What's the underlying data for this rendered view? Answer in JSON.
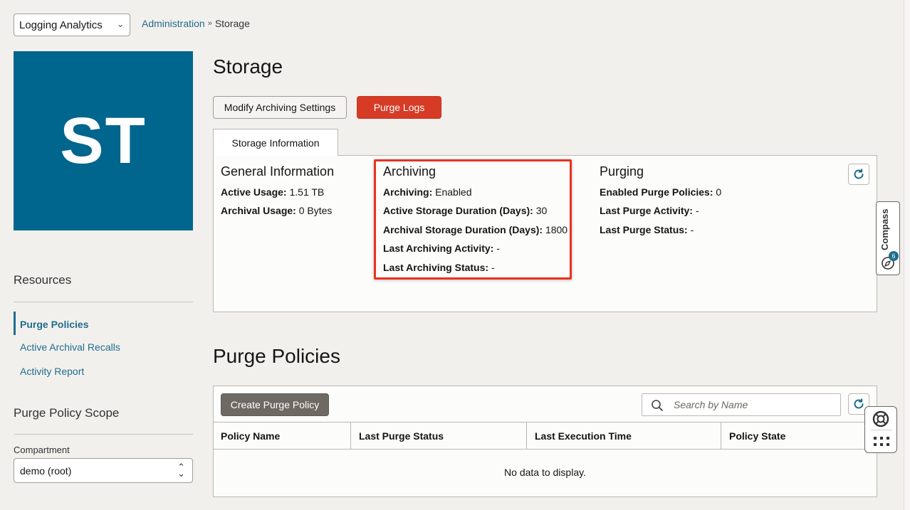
{
  "header": {
    "app_select": "Logging Analytics",
    "breadcrumb": {
      "parent": "Administration",
      "current": "Storage"
    }
  },
  "badge": {
    "initials": "ST",
    "color": "#01668e"
  },
  "sidebar": {
    "resources_heading": "Resources",
    "items": [
      {
        "label": "Purge Policies",
        "active": true
      },
      {
        "label": "Active Archival Recalls",
        "active": false
      },
      {
        "label": "Activity Report",
        "active": false
      }
    ],
    "scope_heading": "Purge Policy Scope",
    "compartment_label": "Compartment",
    "compartment_value": "demo (root)"
  },
  "main": {
    "title": "Storage",
    "buttons": {
      "modify": "Modify Archiving Settings",
      "purge": "Purge Logs"
    },
    "tab": "Storage Information",
    "general": {
      "heading": "General Information",
      "rows": [
        {
          "key": "Active Usage:",
          "value": " 1.51 TB"
        },
        {
          "key": "Archival Usage:",
          "value": " 0 Bytes"
        }
      ]
    },
    "archiving": {
      "heading": "Archiving",
      "rows": [
        {
          "key": "Archiving:",
          "value": " Enabled"
        },
        {
          "key": "Active Storage Duration (Days):",
          "value": " 30"
        },
        {
          "key": "Archival Storage Duration (Days):",
          "value": " 1800"
        },
        {
          "key": "Last Archiving Activity:",
          "value": " -"
        },
        {
          "key": "Last Archiving Status:",
          "value": " -"
        }
      ]
    },
    "purging": {
      "heading": "Purging",
      "rows": [
        {
          "key": "Enabled Purge Policies:",
          "value": " 0"
        },
        {
          "key": "Last Purge Activity:",
          "value": " -"
        },
        {
          "key": "Last Purge Status:",
          "value": " -"
        }
      ]
    },
    "policies": {
      "title": "Purge Policies",
      "create_button": "Create Purge Policy",
      "search_placeholder": "Search by Name",
      "columns": [
        "Policy Name",
        "Last Purge Status",
        "Last Execution Time",
        "Policy State"
      ],
      "empty_text": "No data to display."
    }
  },
  "floating": {
    "compass_label": "Compass",
    "compass_count": "6"
  },
  "colors": {
    "accent": "#1f6d8c",
    "danger": "#d63b25",
    "highlight": "#e8321f"
  }
}
